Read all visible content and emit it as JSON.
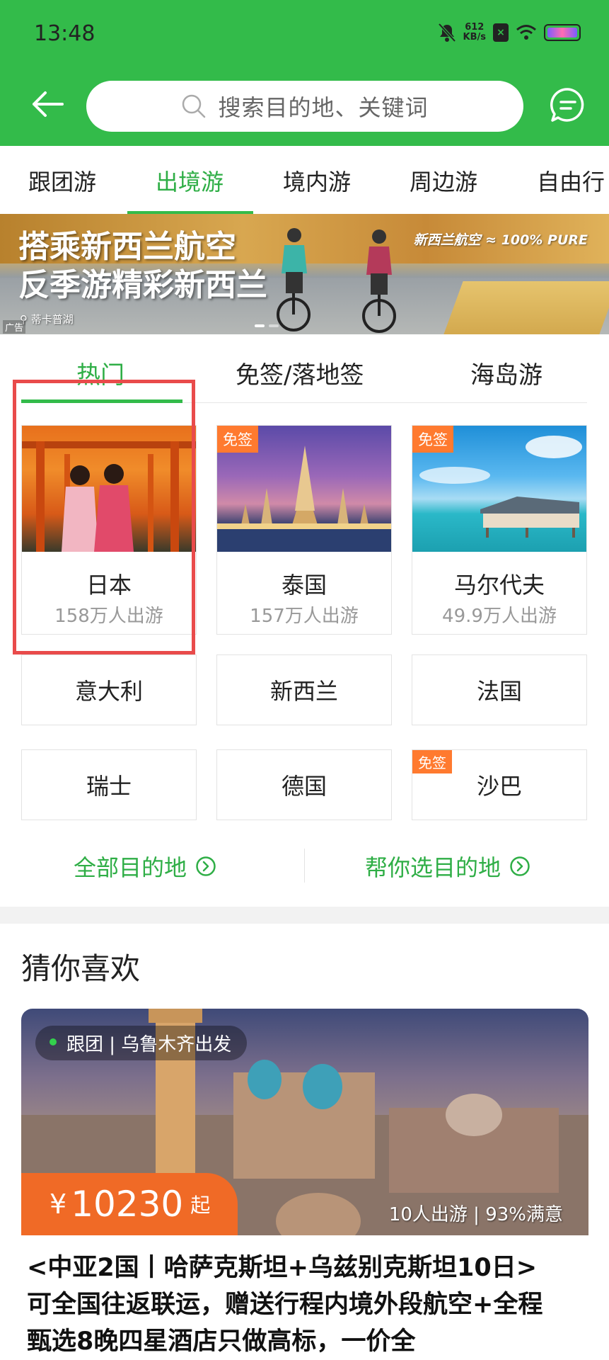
{
  "status_bar": {
    "time": "13:48",
    "net_speed_value": "612",
    "net_speed_unit": "KB/s"
  },
  "search": {
    "placeholder": "搜索目的地、关键词"
  },
  "top_tabs": [
    {
      "label": "跟团游",
      "active": false
    },
    {
      "label": "出境游",
      "active": true
    },
    {
      "label": "境内游",
      "active": false
    },
    {
      "label": "周边游",
      "active": false
    },
    {
      "label": "自由行",
      "active": false
    }
  ],
  "banner": {
    "title_line1": "搭乘新西兰航空",
    "title_line2": "反季游精彩新西兰",
    "brand": "新西兰航空 ≈ 100% PURE",
    "location": "蒂卡普湖",
    "ad_label": "广告"
  },
  "sub_tabs": [
    {
      "label": "热门",
      "active": true
    },
    {
      "label": "免签/落地签",
      "active": false
    },
    {
      "label": "海岛游",
      "active": false
    }
  ],
  "featured": [
    {
      "name": "日本",
      "count": "158万人出游",
      "badge": ""
    },
    {
      "name": "泰国",
      "count": "157万人出游",
      "badge": "免签"
    },
    {
      "name": "马尔代夫",
      "count": "49.9万人出游",
      "badge": "免签"
    }
  ],
  "destinations": [
    {
      "name": "意大利",
      "badge": ""
    },
    {
      "name": "新西兰",
      "badge": ""
    },
    {
      "name": "法国",
      "badge": ""
    },
    {
      "name": "瑞士",
      "badge": ""
    },
    {
      "name": "德国",
      "badge": ""
    },
    {
      "name": "沙巴",
      "badge": "免签"
    }
  ],
  "links": {
    "all": "全部目的地",
    "help": "帮你选目的地"
  },
  "guess": {
    "title": "猜你喜欢",
    "trip": {
      "tag": "跟团 | 乌鲁木齐出发",
      "price_symbol": "¥",
      "price": "10230",
      "price_suffix": "起",
      "stats": "10人出游 | 93%满意",
      "description": "<中亚2国丨哈萨克斯坦+乌兹别克斯坦10日>可全国往返联运，赠送行程内境外段航空+全程甄选8晚四星酒店只做高标，一价全"
    }
  },
  "colors": {
    "brand_green": "#33bb4a",
    "orange": "#f06a26",
    "highlight_red": "#e94b4b"
  }
}
